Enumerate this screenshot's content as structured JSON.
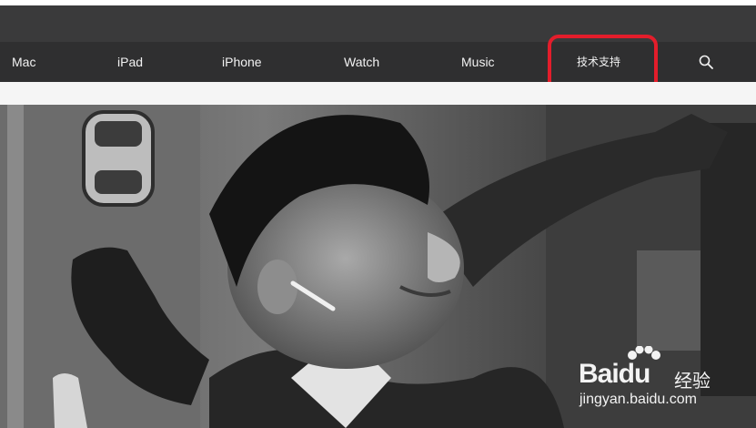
{
  "nav": {
    "items": [
      {
        "label": "Mac"
      },
      {
        "label": "iPad"
      },
      {
        "label": "iPhone"
      },
      {
        "label": "Watch"
      },
      {
        "label": "Music"
      },
      {
        "label": "技术支持"
      }
    ],
    "search_icon": "search-icon"
  },
  "annotation": {
    "color": "#e31d2b",
    "target": "技术支持"
  },
  "hero": {
    "description_icon": "photo"
  },
  "watermark": {
    "brand_latin": "Baidu",
    "brand_cn": "经验",
    "url": "jingyan.baidu.com"
  },
  "colors": {
    "nav_bg": "#2f2f30",
    "top_bar_bg": "#3a3a3b",
    "nav_text": "#f2f2f2"
  }
}
